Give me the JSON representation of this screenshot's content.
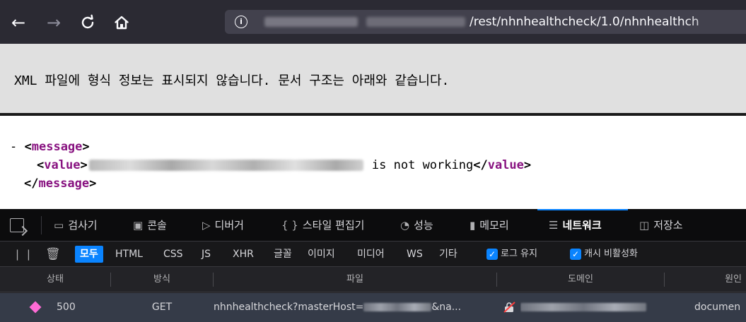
{
  "browser": {
    "nav": {
      "back_icon": "arrow-left-icon",
      "forward_icon": "arrow-right-icon",
      "reload_icon": "reload-icon",
      "home_icon": "home-icon"
    },
    "urlbar": {
      "info_icon": "info-icon",
      "url_visible": "/rest/nhnhealthcheck/1.0/nhnhealthch"
    }
  },
  "xml_viewer": {
    "notice": "XML 파일에 형식 정보는 표시되지 않습니다. 문서 구조는 아래와 같습니다.",
    "tree": {
      "toggle": "-",
      "root_tag": "message",
      "child_tag": "value",
      "child_text_suffix": " is not working"
    }
  },
  "devtools": {
    "tabs": [
      {
        "label": "검사기",
        "icon": "inspector-icon"
      },
      {
        "label": "콘솔",
        "icon": "console-icon"
      },
      {
        "label": "디버거",
        "icon": "debugger-icon"
      },
      {
        "label": "스타일 편집기",
        "icon": "{ }"
      },
      {
        "label": "성능",
        "icon": "performance-icon"
      },
      {
        "label": "메모리",
        "icon": "memory-icon"
      },
      {
        "label": "네트워크",
        "icon": "network-icon",
        "active": true
      },
      {
        "label": "저장소",
        "icon": "storage-icon"
      }
    ],
    "filters": {
      "pause_icon": "pause-icon",
      "trash_icon": "trash-icon",
      "types": [
        "모두",
        "HTML",
        "CSS",
        "JS",
        "XHR",
        "글꼴",
        "이미지",
        "미디어",
        "WS",
        "기타"
      ],
      "active_type": "모두",
      "persist_logs_label": "로그 유지",
      "disable_cache_label": "캐시 비활성화"
    },
    "columns": [
      "상태",
      "방식",
      "파일",
      "도메인",
      "원인"
    ],
    "rows": [
      {
        "status": "500",
        "method": "GET",
        "file_prefix": "nhnhealthcheck?masterHost=",
        "file_suffix": "&na...",
        "domain_icon": "insecure-lock-icon",
        "cause": "documen"
      }
    ],
    "colors": {
      "accent": "#0a84ff",
      "status_error": "#ff6bd5"
    }
  }
}
